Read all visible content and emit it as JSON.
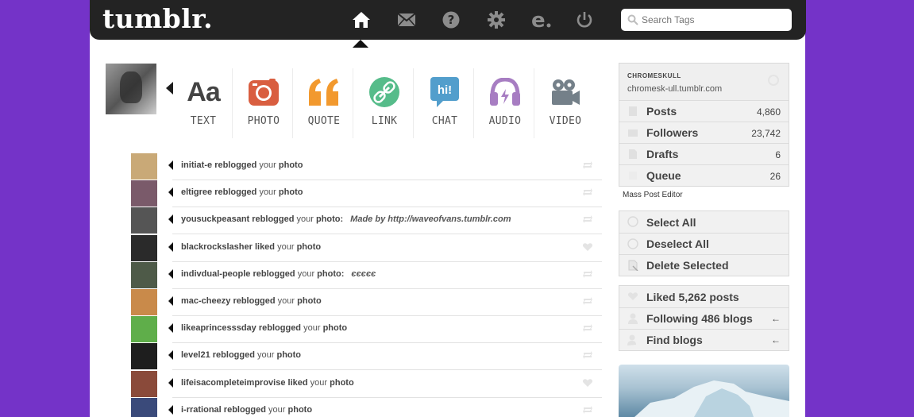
{
  "header": {
    "logo": "tumblr.",
    "search_placeholder": "Search Tags",
    "nav_icons": [
      "home-icon",
      "inbox-icon",
      "help-icon",
      "settings-icon",
      "explore-icon",
      "logout-icon"
    ]
  },
  "post_types": [
    {
      "label": "TEXT",
      "icon": "text-icon",
      "glyph": "Aa",
      "color": "#444444"
    },
    {
      "label": "PHOTO",
      "icon": "photo-icon",
      "color": "#d95e40"
    },
    {
      "label": "QUOTE",
      "icon": "quote-icon",
      "glyph": "“",
      "color": "#f2992e"
    },
    {
      "label": "LINK",
      "icon": "link-icon",
      "color": "#56bc8a"
    },
    {
      "label": "CHAT",
      "icon": "chat-icon",
      "glyph": "hi!",
      "color": "#529ecc"
    },
    {
      "label": "AUDIO",
      "icon": "audio-icon",
      "color": "#a77dc2"
    },
    {
      "label": "VIDEO",
      "icon": "video-icon",
      "color": "#748089"
    }
  ],
  "activity": [
    {
      "user": "initiat-e",
      "action": "reblogged",
      "your": "your",
      "object": "photo",
      "note": "",
      "icon": "reblog-icon",
      "thumb": "#c9a977"
    },
    {
      "user": "eltigree",
      "action": "reblogged",
      "your": "your",
      "object": "photo",
      "note": "",
      "icon": "reblog-icon",
      "thumb": "#7a5a6a"
    },
    {
      "user": "yousuckpeasant",
      "action": "reblogged",
      "your": "your",
      "object": "photo:",
      "note": "Made by http://waveofvans.tumblr.com",
      "icon": "reblog-icon",
      "thumb": "#555555"
    },
    {
      "user": "blackrockslasher",
      "action": "liked",
      "your": "your",
      "object": "photo",
      "note": "",
      "icon": "heart-icon",
      "thumb": "#2a2a2a"
    },
    {
      "user": "indivdual-people",
      "action": "reblogged",
      "your": "your",
      "object": "photo:",
      "note": "єєєєє",
      "icon": "reblog-icon",
      "thumb": "#4e5a48"
    },
    {
      "user": "mac-cheezy",
      "action": "reblogged",
      "your": "your",
      "object": "photo",
      "note": "",
      "icon": "reblog-icon",
      "thumb": "#c98a4a"
    },
    {
      "user": "likeaprincesssday",
      "action": "reblogged",
      "your": "your",
      "object": "photo",
      "note": "",
      "icon": "reblog-icon",
      "thumb": "#5fae4a"
    },
    {
      "user": "level21",
      "action": "reblogged",
      "your": "your",
      "object": "photo",
      "note": "",
      "icon": "reblog-icon",
      "thumb": "#1e1e1e"
    },
    {
      "user": "lifeisacompleteimprovise",
      "action": "liked",
      "your": "your",
      "object": "photo",
      "note": "",
      "icon": "heart-icon",
      "thumb": "#8a4a3a"
    },
    {
      "user": "i-rrational",
      "action": "reblogged",
      "your": "your",
      "object": "photo",
      "note": "",
      "icon": "reblog-icon",
      "thumb": "#3a4a7a"
    }
  ],
  "sidebar": {
    "blog_name": "chromeskull",
    "blog_url": "chromesk-ull.tumblr.com",
    "stats": [
      {
        "label": "Posts",
        "value": "4,860",
        "icon": "posts-icon"
      },
      {
        "label": "Followers",
        "value": "23,742",
        "icon": "followers-icon"
      },
      {
        "label": "Drafts",
        "value": "6",
        "icon": "drafts-icon"
      },
      {
        "label": "Queue",
        "value": "26",
        "icon": "queue-icon"
      }
    ],
    "mass_post_editor": "Mass Post Editor",
    "actions": [
      {
        "label": "Select All",
        "icon": "select-all-icon"
      },
      {
        "label": "Deselect All",
        "icon": "deselect-all-icon"
      },
      {
        "label": "Delete Selected",
        "icon": "delete-icon"
      }
    ],
    "social": [
      {
        "label": "Liked 5,262 posts",
        "icon": "heart-icon",
        "arrow": ""
      },
      {
        "label": "Following 486 blogs",
        "icon": "following-icon",
        "arrow": "←"
      },
      {
        "label": "Find blogs",
        "icon": "find-blogs-icon",
        "arrow": "←"
      }
    ]
  }
}
